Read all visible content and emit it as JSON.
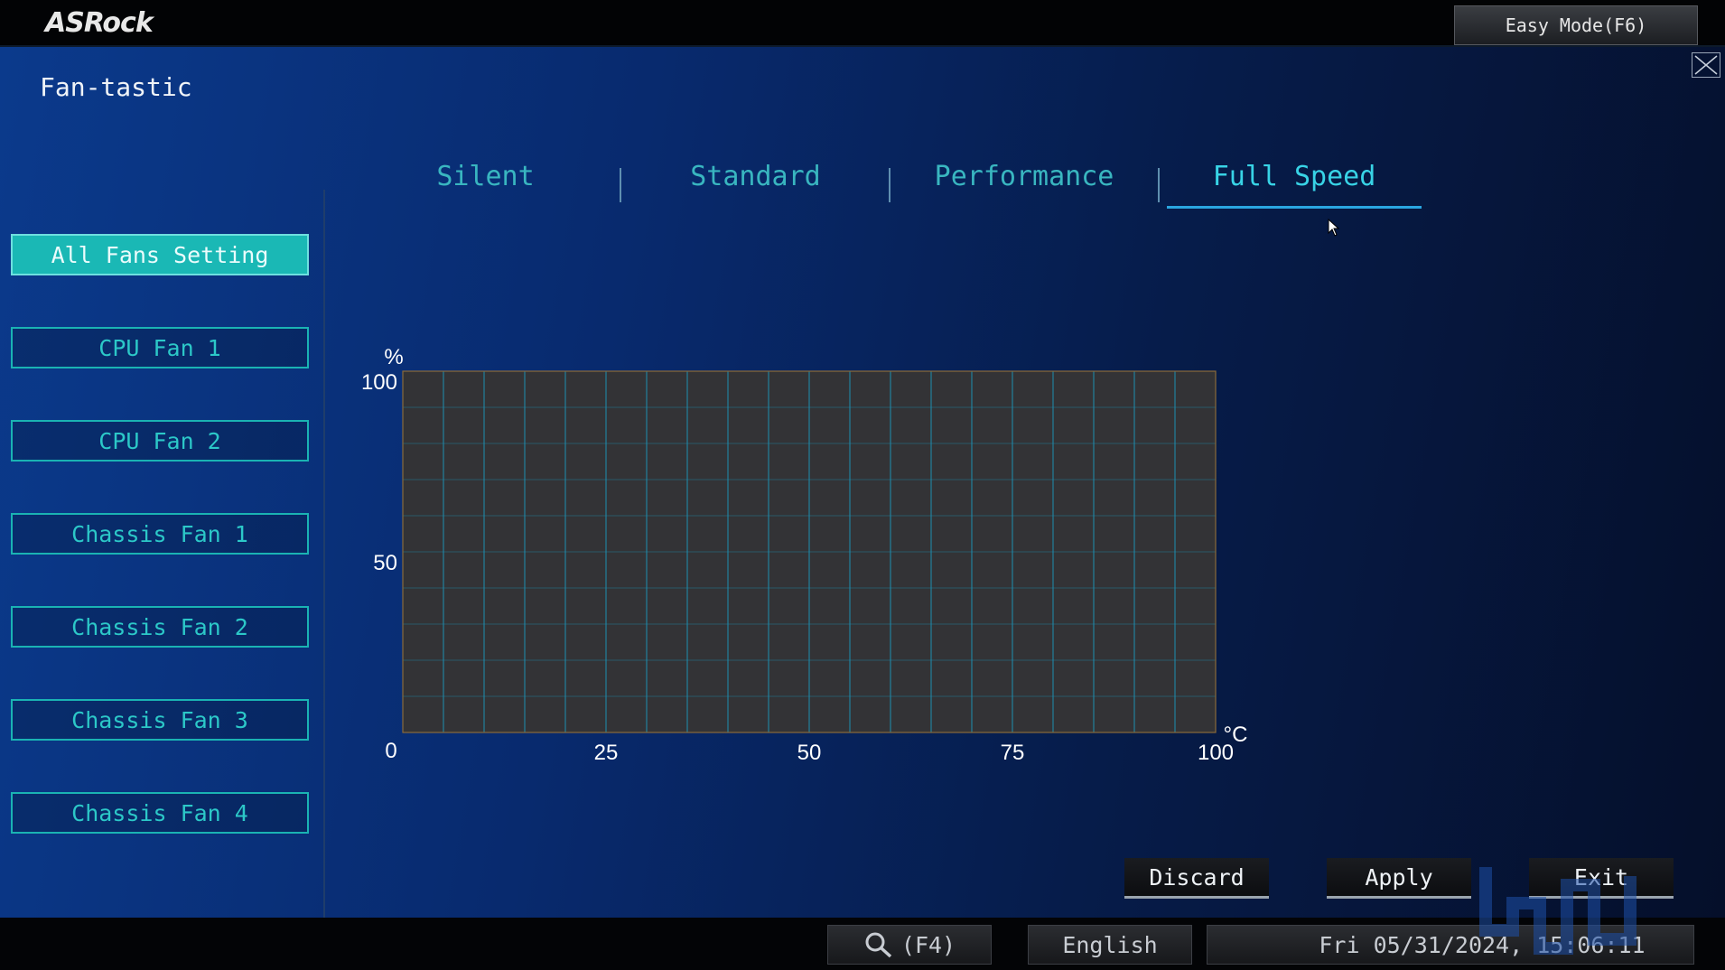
{
  "header": {
    "logo": "ASRock",
    "easy_mode_label": "Easy Mode(F6)"
  },
  "page": {
    "title": "Fan-tastic"
  },
  "sidebar": {
    "items": [
      {
        "label": "All Fans Setting",
        "active": true
      },
      {
        "label": "CPU Fan 1",
        "active": false
      },
      {
        "label": "CPU Fan 2",
        "active": false
      },
      {
        "label": "Chassis Fan 1",
        "active": false
      },
      {
        "label": "Chassis Fan 2",
        "active": false
      },
      {
        "label": "Chassis Fan 3",
        "active": false
      },
      {
        "label": "Chassis Fan 4",
        "active": false
      }
    ]
  },
  "tabs": [
    {
      "label": "Silent",
      "active": false
    },
    {
      "label": "Standard",
      "active": false
    },
    {
      "label": "Performance",
      "active": false
    },
    {
      "label": "Full Speed",
      "active": true
    }
  ],
  "chart": {
    "y_unit": "%",
    "x_unit": "°C",
    "y_ticks": [
      "100",
      "50",
      "0"
    ],
    "x_ticks": [
      "25",
      "50",
      "75",
      "100"
    ]
  },
  "chart_data": {
    "type": "line",
    "x": [],
    "y": [],
    "xlim": [
      0,
      100
    ],
    "ylim": [
      0,
      100
    ],
    "xlabel": "°C",
    "ylabel": "%",
    "grid": true
  },
  "actions": {
    "discard": "Discard",
    "apply": "Apply",
    "exit": "Exit"
  },
  "status": {
    "search_shortcut": "(F4)",
    "language": "English",
    "datetime": "Fri 05/31/2024, 15:06:11"
  },
  "colors": {
    "accent": "#1ab8b5",
    "grid": "#1c8fb0",
    "plot_bg": "#333336"
  }
}
